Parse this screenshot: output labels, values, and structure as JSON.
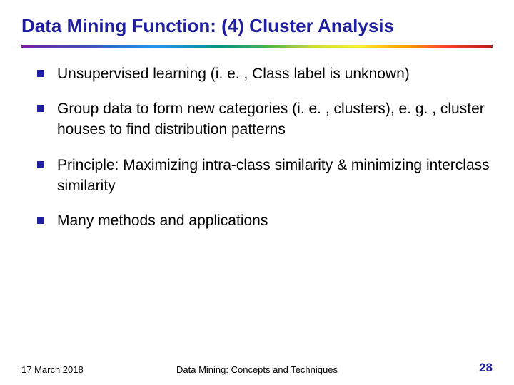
{
  "title": "Data Mining Function: (4) Cluster Analysis",
  "bullets": {
    "b0": "Unsupervised learning (i. e. , Class label is unknown)",
    "b1": "Group data to form new categories (i. e. , clusters), e. g. , cluster houses to find distribution patterns",
    "b2": "Principle: Maximizing intra-class similarity & minimizing interclass similarity",
    "b3": "Many methods and applications"
  },
  "footer": {
    "date": "17 March 2018",
    "center": "Data Mining: Concepts and Techniques",
    "page": "28"
  }
}
